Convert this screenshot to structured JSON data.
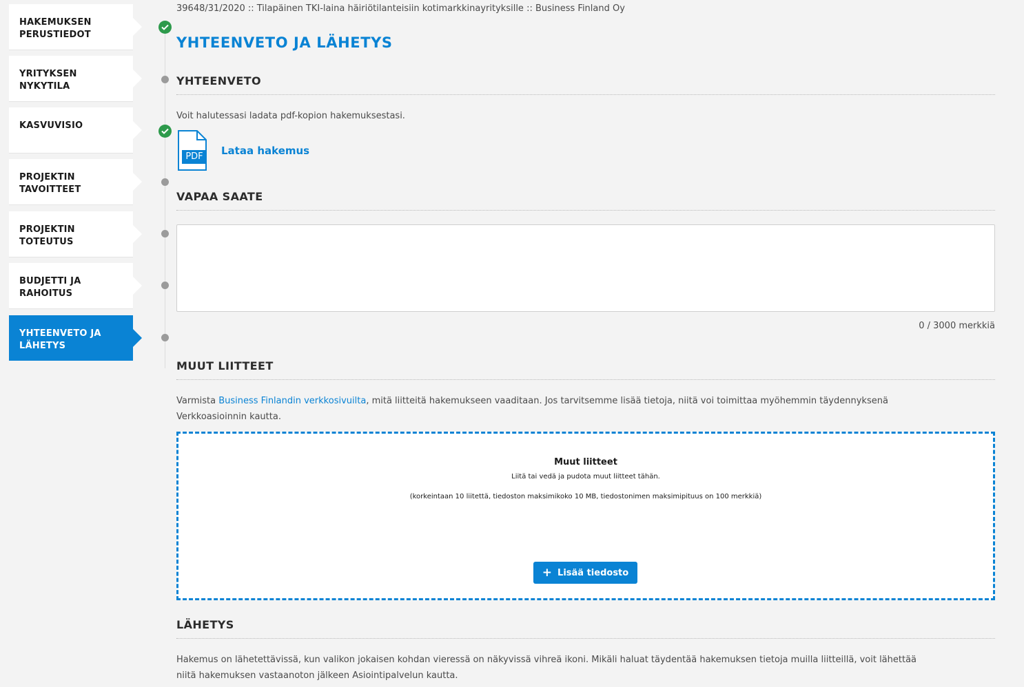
{
  "sidebar": {
    "items": [
      {
        "label": "HAKEMUKSEN PERUSTIEDOT",
        "line1": "HAKEMUKSEN",
        "line2": "PERUSTIEDOT",
        "status": "complete"
      },
      {
        "label": "YRITYKSEN NYKYTILA",
        "line1": "YRITYKSEN",
        "line2": "NYKYTILA",
        "status": "incomplete"
      },
      {
        "label": "KASVUVISIO",
        "line1": "KASVUVISIO",
        "line2": "",
        "status": "complete"
      },
      {
        "label": "PROJEKTIN TAVOITTEET",
        "line1": "PROJEKTIN",
        "line2": "TAVOITTEET",
        "status": "incomplete"
      },
      {
        "label": "PROJEKTIN TOTEUTUS",
        "line1": "PROJEKTIN",
        "line2": "TOTEUTUS",
        "status": "incomplete"
      },
      {
        "label": "BUDJETTI JA RAHOITUS",
        "line1": "BUDJETTI JA",
        "line2": "RAHOITUS",
        "status": "incomplete"
      },
      {
        "label": "YHTEENVETO JA LÄHETYS",
        "line1": "YHTEENVETO JA",
        "line2": "LÄHETYS",
        "status": "incomplete",
        "active": true
      }
    ]
  },
  "breadcrumb": "39648/31/2020 :: Tilapäinen TKI-laina häiriötilanteisiin kotimarkkinayrityksille :: Business Finland Oy",
  "page_title": "YHTEENVETO JA LÄHETYS",
  "summary": {
    "title": "YHTEENVETO",
    "text": "Voit halutessasi ladata pdf-kopion hakemuksestasi.",
    "pdf_badge": "PDF",
    "download_label": "Lataa hakemus"
  },
  "cover_letter": {
    "title": "VAPAA SAATE",
    "value": "",
    "char_count": "0 / 3000 merkkiä"
  },
  "attachments": {
    "title": "MUUT LIITTEET",
    "text_before": "Varmista ",
    "link": "Business Finlandin verkkosivuilta",
    "text_after_line1": ", mitä liitteitä hakemukseen vaaditaan. Jos tarvitsemme lisää tietoja, niitä voi toimittaa myöhemmin täydennyksenä",
    "text_line2": "Verkkoasioinnin kautta.",
    "dropzone_title": "Muut liitteet",
    "dropzone_sub": "Liitä tai vedä ja pudota muut liitteet tähän.",
    "dropzone_limits": "(korkeintaan 10 liitettä, tiedoston maksimikoko 10 MB, tiedostonimen maksimipituus on 100 merkkiä)",
    "add_button": "Lisää tiedosto"
  },
  "sending": {
    "title": "LÄHETYS",
    "text_line1": "Hakemus on lähetettävissä, kun valikon jokaisen kohdan vieressä on näkyvissä vihreä ikoni. Mikäli haluat täydentää hakemuksen tietoja muilla liitteillä, voit lähettää",
    "text_line2": "niitä hakemuksen vastaanoton jälkeen Asiointipalvelun kautta."
  },
  "colors": {
    "accent": "#0a83d4",
    "complete": "#2d9a4b",
    "incomplete": "#9b9b9b"
  }
}
